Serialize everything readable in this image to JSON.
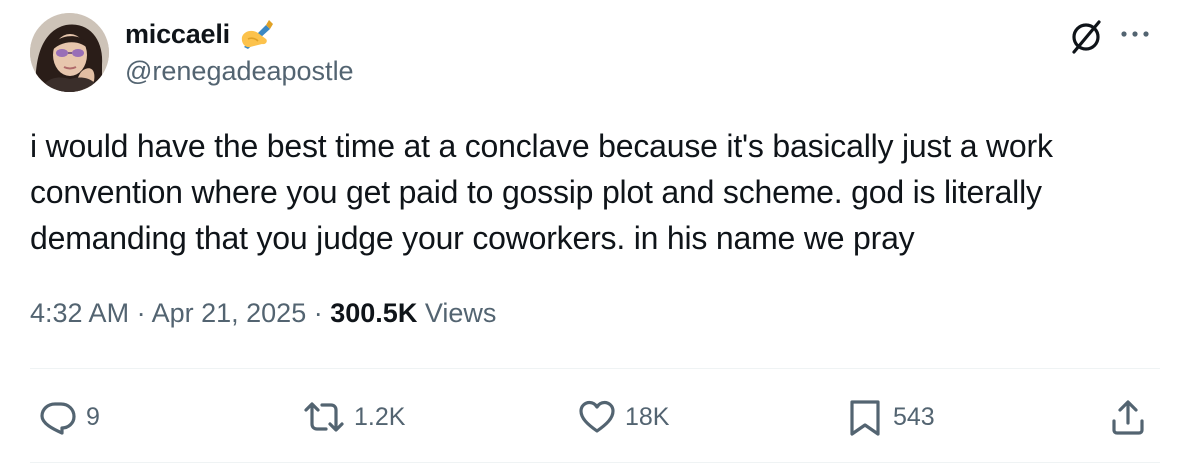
{
  "tweet": {
    "author": {
      "display_name": "miccaeli",
      "name_emoji": "writing-hand-icon",
      "handle": "@renegadeapostle"
    },
    "text": "i would have the best time at a conclave because it's basically just a work convention where you get paid to gossip plot and scheme. god is literally demanding that you judge your coworkers. in his name we pray",
    "time": "4:32 AM",
    "separator": "·",
    "date": "Apr 21, 2025",
    "views_count": "300.5K",
    "views_label": "Views"
  },
  "actions": {
    "replies": "9",
    "retweets": "1.2K",
    "likes": "18K",
    "bookmarks": "543"
  },
  "colors": {
    "text_primary": "#0f1419",
    "text_secondary": "#536471",
    "divider": "#eff3f4"
  }
}
